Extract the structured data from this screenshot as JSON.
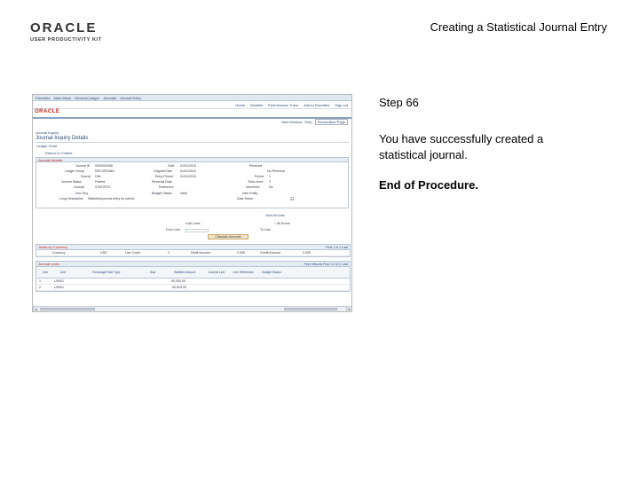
{
  "logo": {
    "brand": "ORACLE",
    "product": "USER PRODUCTIVITY KIT"
  },
  "slide": {
    "title": "Creating a Statistical Journal Entry",
    "step": "Step 66",
    "description": "You have successfully created a statistical journal.",
    "end": "End of Procedure."
  },
  "screenshot": {
    "topnav": [
      "Favorites",
      "Main Menu",
      "General Ledger",
      "Journals",
      "Journal Entry"
    ],
    "menubar": [
      "Home",
      "Worklist",
      "Performance Trace",
      "Add to Favorites",
      "Sign out"
    ],
    "brand": "ORACLE",
    "helpbar": [
      "New Window",
      "Help",
      "Personalize Page"
    ],
    "breadcrumb": "Journal Inquiry",
    "heading": "Journal Inquiry Details",
    "ledger_link": "Ledger Chart",
    "return_link": "Return to Criteria",
    "header_group": "Journal Header",
    "fields": [
      {
        "label": "Journal ID",
        "value": "0000000456"
      },
      {
        "label": "Date",
        "value": "01/01/2010"
      },
      {
        "label": "Reversal",
        "value": "No Reversal"
      },
      {
        "label": "Ledger Group",
        "value": "RECORDING"
      },
      {
        "label": "Original Date",
        "value": "01/01/2010"
      },
      {
        "label": "Period",
        "value": "1"
      },
      {
        "label": "Source",
        "value": "ONL"
      },
      {
        "label": "Entry Period",
        "value": "01/01/2010"
      },
      {
        "label": "Total Lines",
        "value": "2"
      },
      {
        "label": "Journal Status",
        "value": "Posted"
      },
      {
        "label": "Reversal Date",
        "value": ""
      },
      {
        "label": "Inter/Intra",
        "value": "No"
      },
      {
        "label": "Journal",
        "value": "STATISTIC"
      },
      {
        "label": "Reference",
        "value": ""
      },
      {
        "label": "Inter Entity",
        "value": ""
      },
      {
        "label": "Doc Seq",
        "value": ""
      },
      {
        "label": "Budget Status",
        "value": "Valid"
      },
      {
        "label": "Date Rules",
        "value": ""
      },
      {
        "label": "Long Description",
        "value": "Statistical journal entry for period"
      }
    ],
    "view_all_lines": "View All Lines",
    "all_lines": "All Lines",
    "all_errors": "All Errors",
    "from_line": "From Line",
    "to_line": "To Line",
    "calc_button": "Calculate Amounts",
    "totals_title": "Totals by Currency",
    "totals_nav": "First  1 of 1  Last",
    "totals_row": [
      "Currency",
      "USD",
      "Line Count",
      "2",
      "Debit Amount",
      "0.000",
      "Credit Amount",
      "0.000"
    ],
    "lines_title": "Journal Lines",
    "lines_nav": "Find  View All  First  1-2 of 2  Last",
    "line_columns": [
      "Line",
      "Unit",
      "Exchange Rate Type",
      "Stat",
      "Statistic Amount",
      "Journal Line",
      "Line Reference",
      "Budget Status"
    ],
    "lines": [
      {
        "line": "1",
        "unit": "US001",
        "stat": "",
        "amount": "50,000.00"
      },
      {
        "line": "2",
        "unit": "US001",
        "stat": "",
        "amount": "-50,000.00"
      }
    ]
  }
}
